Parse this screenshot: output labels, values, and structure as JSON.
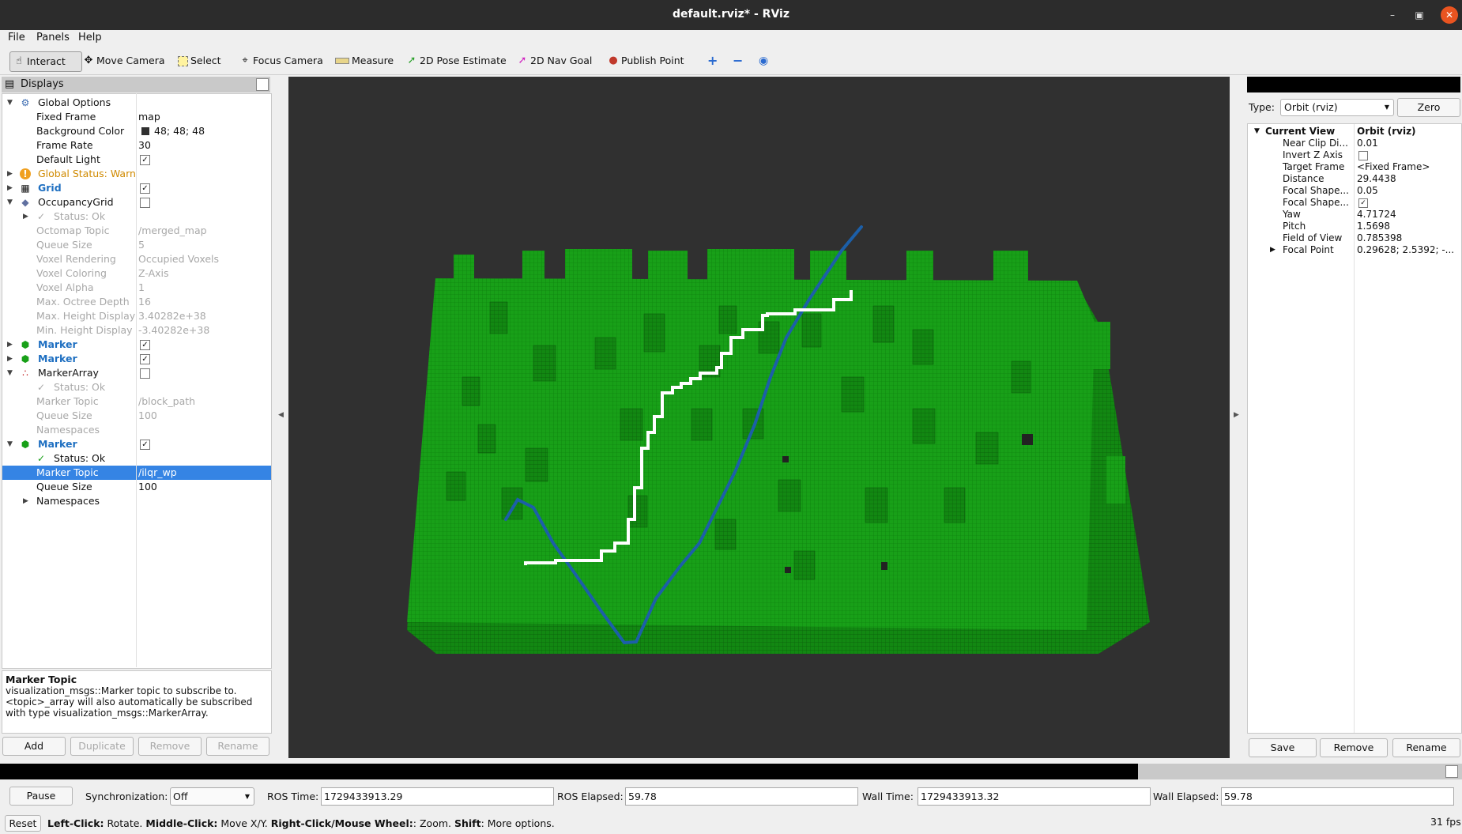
{
  "window": {
    "title": "default.rviz* - RViz"
  },
  "menu": [
    "File",
    "Panels",
    "Help"
  ],
  "toolbar": {
    "interact": "Interact",
    "move_camera": "Move Camera",
    "select": "Select",
    "focus_camera": "Focus Camera",
    "measure": "Measure",
    "pose_estimate": "2D Pose Estimate",
    "nav_goal": "2D Nav Goal",
    "publish_point": "Publish Point"
  },
  "displays": {
    "title": "Displays",
    "rows": [
      {
        "label": "Global Options",
        "value": ""
      },
      {
        "label": "Fixed Frame",
        "value": "map"
      },
      {
        "label": "Background Color",
        "value": "48; 48; 48"
      },
      {
        "label": "Frame Rate",
        "value": "30"
      },
      {
        "label": "Default Light",
        "value": ""
      },
      {
        "label": "Global Status: Warn",
        "value": ""
      },
      {
        "label": "Grid",
        "value": ""
      },
      {
        "label": "OccupancyGrid",
        "value": ""
      },
      {
        "label": "Status: Ok",
        "value": ""
      },
      {
        "label": "Octomap Topic",
        "value": "/merged_map"
      },
      {
        "label": "Queue Size",
        "value": "5"
      },
      {
        "label": "Voxel Rendering",
        "value": "Occupied Voxels"
      },
      {
        "label": "Voxel Coloring",
        "value": "Z-Axis"
      },
      {
        "label": "Voxel Alpha",
        "value": "1"
      },
      {
        "label": "Max. Octree Depth",
        "value": "16"
      },
      {
        "label": "Max. Height Display",
        "value": "3.40282e+38"
      },
      {
        "label": "Min. Height Display",
        "value": "-3.40282e+38"
      },
      {
        "label": "Marker",
        "value": ""
      },
      {
        "label": "Marker",
        "value": ""
      },
      {
        "label": "MarkerArray",
        "value": ""
      },
      {
        "label": "Status: Ok",
        "value": ""
      },
      {
        "label": "Marker Topic",
        "value": "/block_path"
      },
      {
        "label": "Queue Size",
        "value": "100"
      },
      {
        "label": "Namespaces",
        "value": ""
      },
      {
        "label": "Marker",
        "value": ""
      },
      {
        "label": "Status: Ok",
        "value": ""
      },
      {
        "label": "Marker Topic",
        "value": "/ilqr_wp"
      },
      {
        "label": "Queue Size",
        "value": "100"
      },
      {
        "label": "Namespaces",
        "value": ""
      }
    ],
    "desc_title": "Marker Topic",
    "desc_text": "visualization_msgs::Marker topic to subscribe to. <topic>_array will also automatically be subscribed with type visualization_msgs::MarkerArray.",
    "buttons": {
      "add": "Add",
      "duplicate": "Duplicate",
      "remove": "Remove",
      "rename": "Rename"
    }
  },
  "views": {
    "type_label": "Type:",
    "type_value": "Orbit (rviz)",
    "zero": "Zero",
    "rows": [
      {
        "label": "Current View",
        "value": "Orbit (rviz)"
      },
      {
        "label": "Near Clip Di...",
        "value": "0.01"
      },
      {
        "label": "Invert Z Axis",
        "value": ""
      },
      {
        "label": "Target Frame",
        "value": "<Fixed Frame>"
      },
      {
        "label": "Distance",
        "value": "29.4438"
      },
      {
        "label": "Focal Shape...",
        "value": "0.05"
      },
      {
        "label": "Focal Shape...",
        "value": ""
      },
      {
        "label": "Yaw",
        "value": "4.71724"
      },
      {
        "label": "Pitch",
        "value": "1.5698"
      },
      {
        "label": "Field of View",
        "value": "0.785398"
      },
      {
        "label": "Focal Point",
        "value": "0.29628; 2.5392; -..."
      }
    ],
    "buttons": {
      "save": "Save",
      "remove": "Remove",
      "rename": "Rename"
    }
  },
  "time": {
    "pause": "Pause",
    "sync_label": "Synchronization:",
    "sync_value": "Off",
    "ros_time_label": "ROS Time:",
    "ros_time": "1729433913.29",
    "ros_elapsed_label": "ROS Elapsed:",
    "ros_elapsed": "59.78",
    "wall_time_label": "Wall Time:",
    "wall_time": "1729433913.32",
    "wall_elapsed_label": "Wall Elapsed:",
    "wall_elapsed": "59.78"
  },
  "status": {
    "reset": "Reset",
    "left_click": "Left-Click:",
    "left_click_desc": " Rotate. ",
    "middle_click": "Middle-Click:",
    "middle_click_desc": " Move X/Y. ",
    "right_click": "Right-Click/Mouse Wheel:",
    "right_click_desc": ": Zoom. ",
    "shift": "Shift",
    "shift_desc": ": More options.",
    "fps": "31 fps"
  },
  "colors": {
    "viewport_bg": "#303030",
    "map_green": "#18a018",
    "path_white": "#ffffff",
    "path_blue": "#1c5fa8",
    "selection": "#3584e4"
  }
}
